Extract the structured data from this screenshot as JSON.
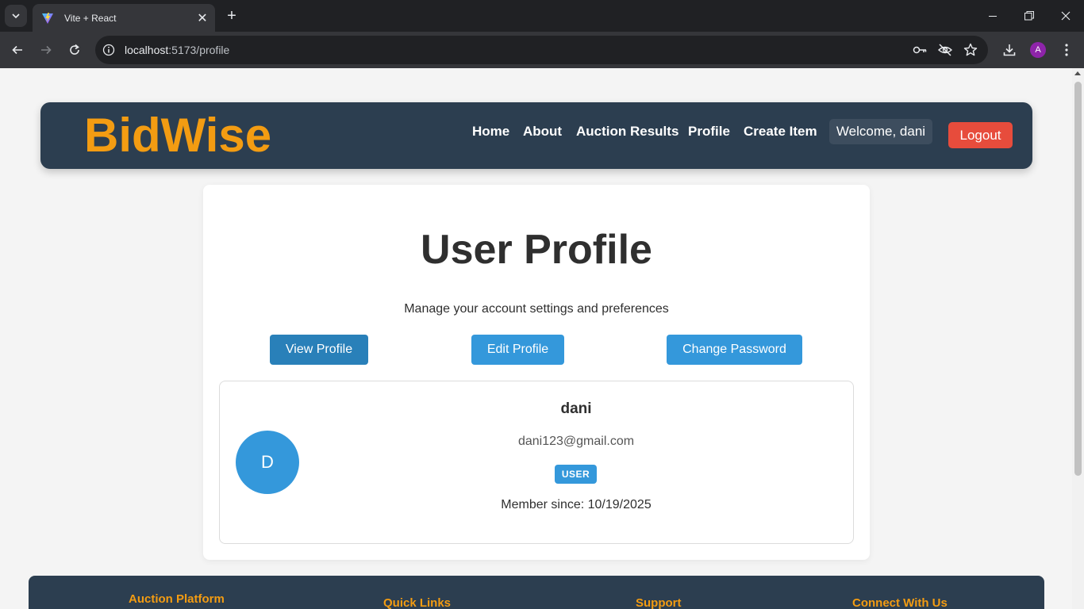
{
  "browser": {
    "tab_title": "Vite + React",
    "url_host": "localhost",
    "url_rest": ":5173/profile",
    "profile_initial": "A"
  },
  "header": {
    "logo": "BidWise",
    "nav": [
      "Home",
      "About",
      "Auction Results",
      "Profile",
      "Create Item"
    ],
    "welcome": "Welcome, dani",
    "logout": "Logout"
  },
  "page": {
    "title": "User Profile",
    "subtitle": "Manage your account settings and preferences",
    "tabs": [
      "View Profile",
      "Edit Profile",
      "Change Password"
    ],
    "active_tab": "View Profile"
  },
  "profile": {
    "initial": "D",
    "username": "dani",
    "email": "dani123@gmail.com",
    "role": "USER",
    "member_since": "Member since: 10/19/2025"
  },
  "footer": {
    "columns": [
      "Auction Platform",
      "Quick Links",
      "Support",
      "Connect With Us"
    ]
  },
  "colors": {
    "navy": "#2c3e50",
    "brand_orange": "#f39c12",
    "button_blue": "#3498db",
    "active_blue": "#2980b9",
    "logout_red": "#e74c3c"
  }
}
